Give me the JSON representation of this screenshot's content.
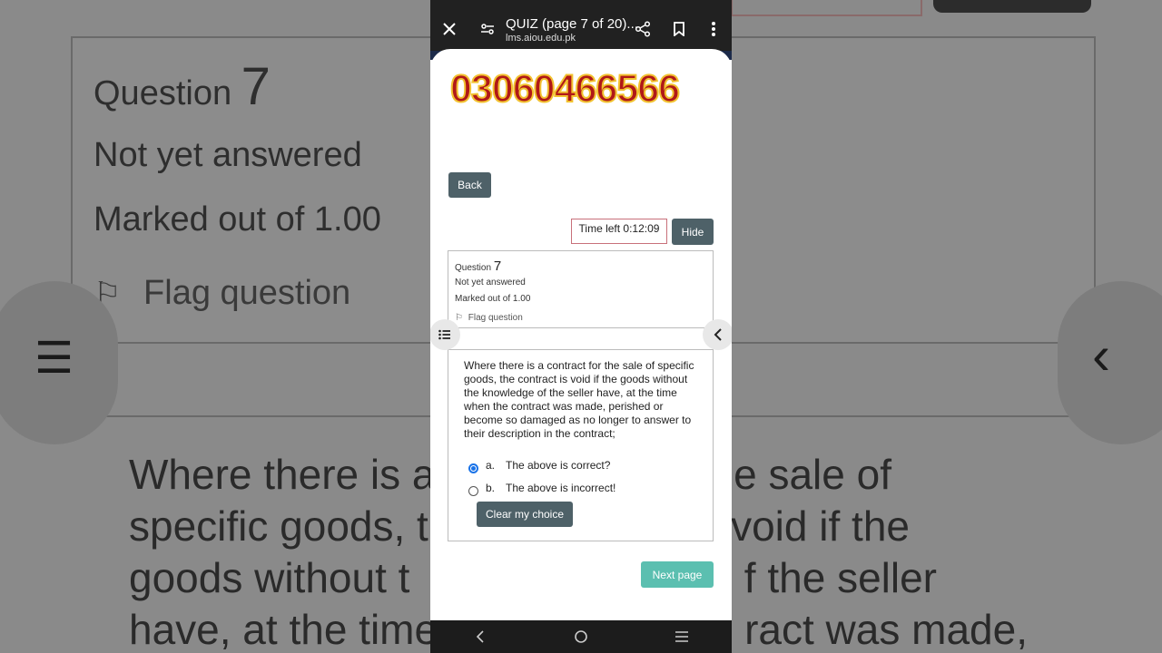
{
  "background": {
    "question_label": "Question",
    "question_number": "7",
    "status": "Not yet answered",
    "marked": "Marked out of 1.00",
    "flag": "Flag question",
    "body_lines": [
      "Where there is a",
      "e sale of",
      "specific goods, t",
      "void if the",
      "goods without t",
      "f the seller",
      "have, at the time",
      "ract was made,"
    ]
  },
  "topbar": {
    "close_icon": "close-icon",
    "settings_icon": "page-settings-icon",
    "title": "QUIZ (page 7 of 20)...",
    "url": "lms.aiou.edu.pk",
    "share_icon": "share-icon",
    "bookmark_icon": "bookmark-icon",
    "menu_icon": "more-vert-icon"
  },
  "banner_number": "03060466566",
  "back_label": "Back",
  "timer": {
    "text": "Time left 0:12:09",
    "hide_label": "Hide"
  },
  "question": {
    "label": "Question",
    "number": "7",
    "status": "Not yet answered",
    "marked": "Marked out of 1.00",
    "flag_label": "Flag question",
    "text": "Where there is a contract for the sale of specific goods, the contract is void if the goods without the knowledge of the seller have, at the time when the contract was made, perished or become so damaged as no longer to answer to their description in the contract;",
    "options": [
      {
        "letter": "a.",
        "label": "The above is correct?",
        "selected": true
      },
      {
        "letter": "b.",
        "label": "The above is incorrect!",
        "selected": false
      }
    ],
    "clear_label": "Clear my choice"
  },
  "next_label": "Next page",
  "colors": {
    "accent_dark": "#4e6168",
    "next_button": "#5bbfb0",
    "radio_selected": "#1a73e8",
    "banner_text": "#b01818",
    "banner_outline": "#f2c230"
  }
}
